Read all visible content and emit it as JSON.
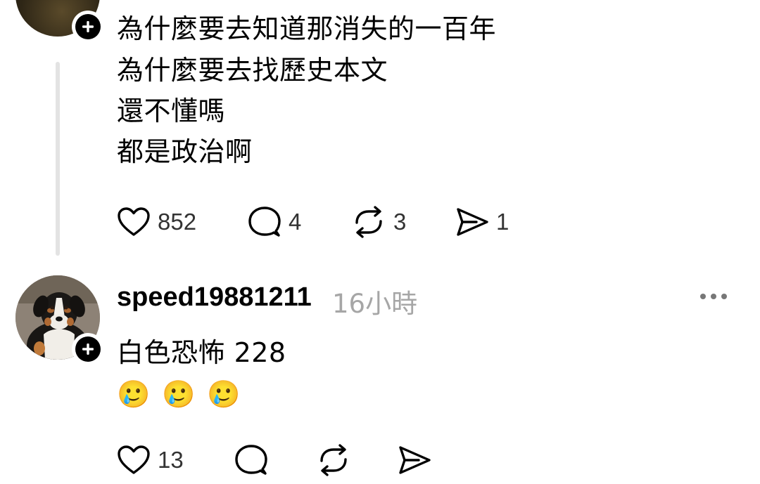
{
  "post": {
    "lines": [
      "為什麼要去知道那消失的一百年",
      "為什麼要去找歷史本文",
      "還不懂嗎",
      "都是政治啊"
    ],
    "likes": "852",
    "replies": "4",
    "reposts": "3",
    "shares": "1"
  },
  "reply": {
    "username": "speed19881211",
    "timestamp": "16小時",
    "text": "白色恐怖  228",
    "emojis": [
      "🥲",
      "🥲",
      "🥲"
    ],
    "likes": "13"
  },
  "colors": {
    "thread_line": "#e3e3e3",
    "timestamp": "#a6a6a6",
    "text": "#000000"
  }
}
